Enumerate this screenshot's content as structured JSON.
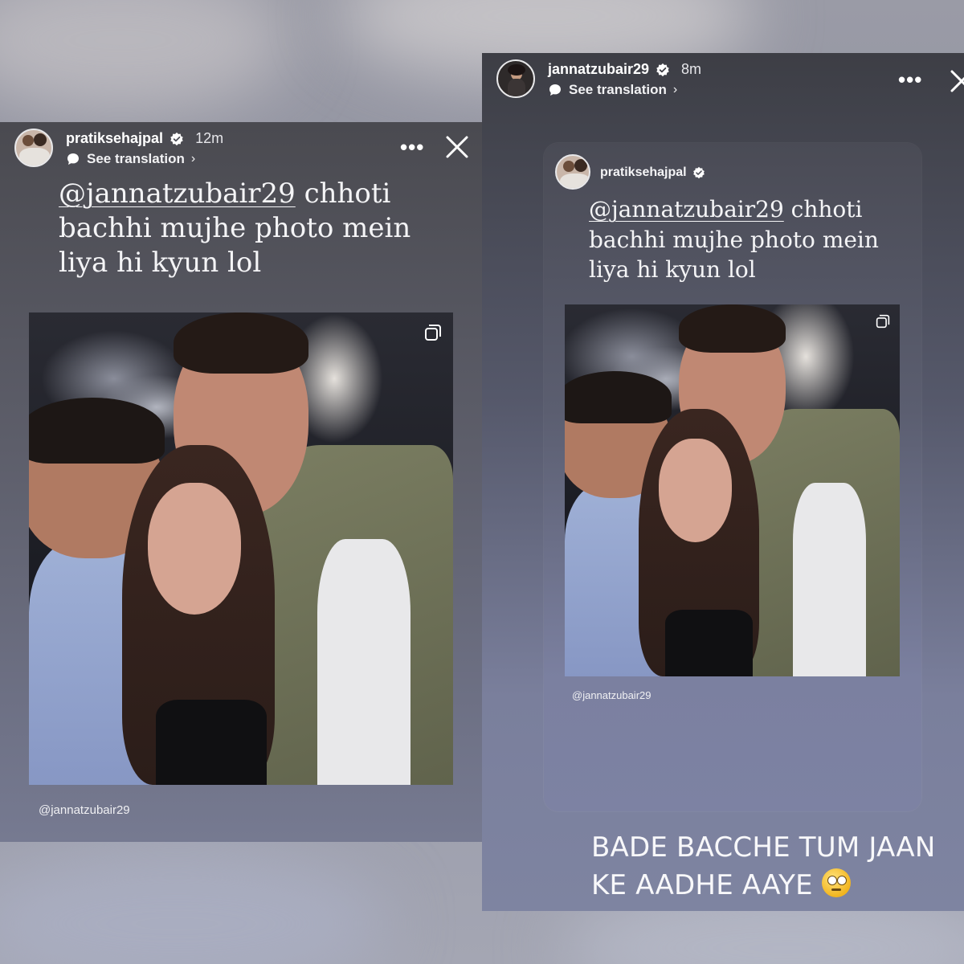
{
  "left_story": {
    "username": "pratiksehajpal",
    "time": "12m",
    "translate_label": "See translation",
    "more_label": "•••",
    "caption_mention": "@jannatzubair29",
    "caption_line1_rest": " chhoti",
    "caption_line2": "bachhi mujhe photo mein",
    "caption_line3": "liya hi kyun lol",
    "photo_credit": "@jannatzubair29"
  },
  "right_story": {
    "username": "jannatzubair29",
    "time": "8m",
    "translate_label": "See translation",
    "more_label": "•••",
    "shared_card": {
      "username": "pratiksehajpal",
      "caption_mention": "@jannatzubair29",
      "caption_line1_rest": " chhoti",
      "caption_line2": "bachhi mujhe photo mein",
      "caption_line3": "liya hi kyun lol",
      "photo_credit": "@jannatzubair29"
    },
    "overlay_line1": "BADE BACCHE TUM JAAN",
    "overlay_line2": "KE AADHE AAYE",
    "overlay_emoji": "face-with-rolling-eyes-emoji"
  },
  "colors": {
    "verified_badge": "#ffffff",
    "text_light": "#f4f4f6"
  }
}
